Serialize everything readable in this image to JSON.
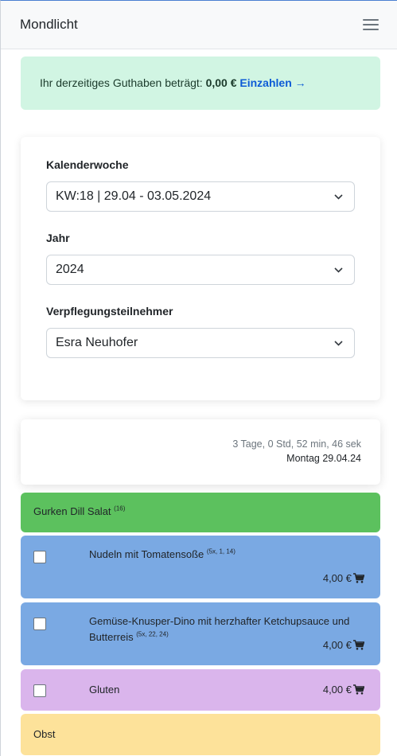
{
  "navbar": {
    "brand": "Mondlicht",
    "menu_icon": "hamburger-icon"
  },
  "balance": {
    "text": "Ihr derzeitiges Guthaben beträgt:",
    "amount": "0,00 €",
    "link": "Einzahlen →"
  },
  "form": {
    "week": {
      "label": "Kalenderwoche",
      "value": "KW:18 | 29.04 - 03.05.2024"
    },
    "year": {
      "label": "Jahr",
      "value": "2024"
    },
    "participant": {
      "label": "Verpflegungsteilnehmer",
      "value": "Esra Neuhofer"
    }
  },
  "day": {
    "countdown": "3 Tage, 0 Std, 52 min, 46 sek",
    "date": "Montag 29.04.24"
  },
  "meals": [
    {
      "name": "Gurken Dill Salat",
      "allergens": "(16)",
      "color": "#5cc15e"
    },
    {
      "name": "Nudeln mit Tomatensoße",
      "allergens": "(5x, 1, 14)",
      "price": "4,00 €",
      "checked": false,
      "color": "#7aa9e3"
    },
    {
      "name": "Gemüse-Knusper-Dino mit herzhafter Ketchupsauce und Butterreis",
      "allergens": "(5x, 22, 24)",
      "price": "4,00 €",
      "checked": false,
      "color": "#7aa9e3"
    },
    {
      "name": "Gluten",
      "price": "4,00 €",
      "checked": false,
      "color": "#dab5ec"
    },
    {
      "name": "Obst",
      "color": "#fde29a"
    }
  ],
  "icons": {
    "select_arrow": "chevron-down-icon",
    "cart": "cart-icon"
  }
}
